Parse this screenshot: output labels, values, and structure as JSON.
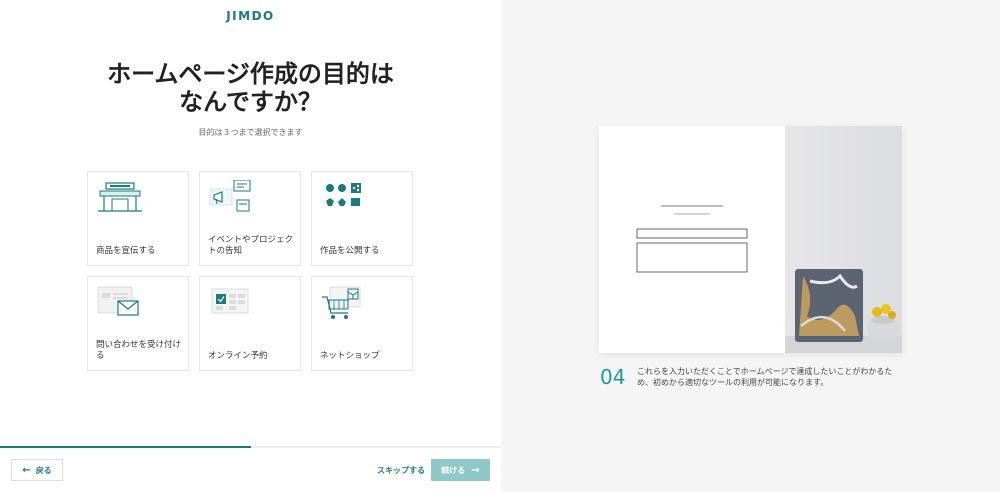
{
  "brand": {
    "logo_text": "JIMDO",
    "accent": "#1a7a7f"
  },
  "question": {
    "title_line1": "ホームページ作成の目的は",
    "title_line2": "なんですか？",
    "subtitle": "目的は３つまで選択できます"
  },
  "options": [
    {
      "label": "商品を宣伝する",
      "icon": "storefront-icon"
    },
    {
      "label": "イベントやプロジェクトの告知",
      "icon": "megaphone-chat-icon"
    },
    {
      "label": "作品を公開する",
      "icon": "share-gallery-icon"
    },
    {
      "label": "問い合わせを受け付ける",
      "icon": "mail-form-icon"
    },
    {
      "label": "オンライン予約",
      "icon": "calendar-check-icon"
    },
    {
      "label": "ネットショップ",
      "icon": "shopping-cart-icon"
    }
  ],
  "progress": {
    "fraction": 0.5
  },
  "footer": {
    "back_label": "戻る",
    "skip_label": "スキップする",
    "next_label": "続ける"
  },
  "side_panel": {
    "step_number": "04",
    "step_text": "これらを入力いただくことでホームページで達成したいことがわかるため、初めから適切なツールの利用が可能になります。"
  }
}
